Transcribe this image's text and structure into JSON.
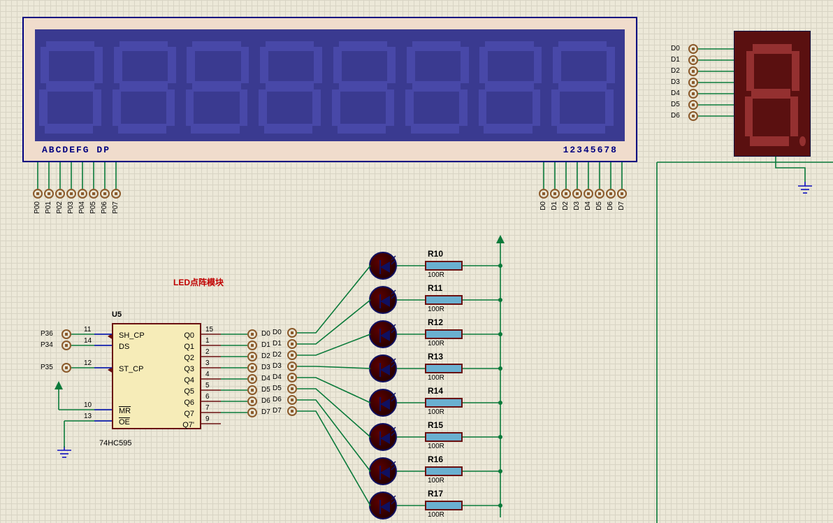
{
  "display8": {
    "segments_label": "ABCDEFG  DP",
    "digits_label": "12345678",
    "seg_pins": [
      "P00",
      "P01",
      "P02",
      "P03",
      "P04",
      "P05",
      "P06",
      "P07"
    ],
    "digit_pins": [
      "D0",
      "D1",
      "D2",
      "D3",
      "D4",
      "D5",
      "D6",
      "D7"
    ]
  },
  "single7seg": {
    "pins": [
      "D0",
      "D1",
      "D2",
      "D3",
      "D4",
      "D5",
      "D6"
    ]
  },
  "led_module": {
    "title": "LED点阵模块"
  },
  "chip": {
    "ref": "U5",
    "part": "74HC595",
    "left_pins": [
      {
        "num": "11",
        "name": "SH_CP",
        "net": "P36"
      },
      {
        "num": "14",
        "name": "DS",
        "net": "P34"
      },
      {
        "num": "12",
        "name": "ST_CP",
        "net": "P35"
      },
      {
        "num": "10",
        "name": "MR",
        "overline": true,
        "net": ""
      },
      {
        "num": "13",
        "name": "OE",
        "overline": true,
        "net": ""
      }
    ],
    "right_pins": [
      {
        "num": "15",
        "name": "Q0",
        "net": "D0"
      },
      {
        "num": "1",
        "name": "Q1",
        "net": "D1"
      },
      {
        "num": "2",
        "name": "Q2",
        "net": "D2"
      },
      {
        "num": "3",
        "name": "Q3",
        "net": "D3"
      },
      {
        "num": "4",
        "name": "Q4",
        "net": "D4"
      },
      {
        "num": "5",
        "name": "Q5",
        "net": "D5"
      },
      {
        "num": "6",
        "name": "Q6",
        "net": "D6"
      },
      {
        "num": "7",
        "name": "Q7",
        "net": "D7"
      },
      {
        "num": "9",
        "name": "Q7'",
        "net": ""
      }
    ]
  },
  "leds": {
    "inputs": [
      "D0",
      "D1",
      "D2",
      "D3",
      "D4",
      "D5",
      "D6",
      "D7"
    ],
    "resistors": [
      {
        "ref": "R10",
        "val": "100R"
      },
      {
        "ref": "R11",
        "val": "100R"
      },
      {
        "ref": "R12",
        "val": "100R"
      },
      {
        "ref": "R13",
        "val": "100R"
      },
      {
        "ref": "R14",
        "val": "100R"
      },
      {
        "ref": "R15",
        "val": "100R"
      },
      {
        "ref": "R16",
        "val": "100R"
      },
      {
        "ref": "R17",
        "val": "100R"
      }
    ]
  }
}
